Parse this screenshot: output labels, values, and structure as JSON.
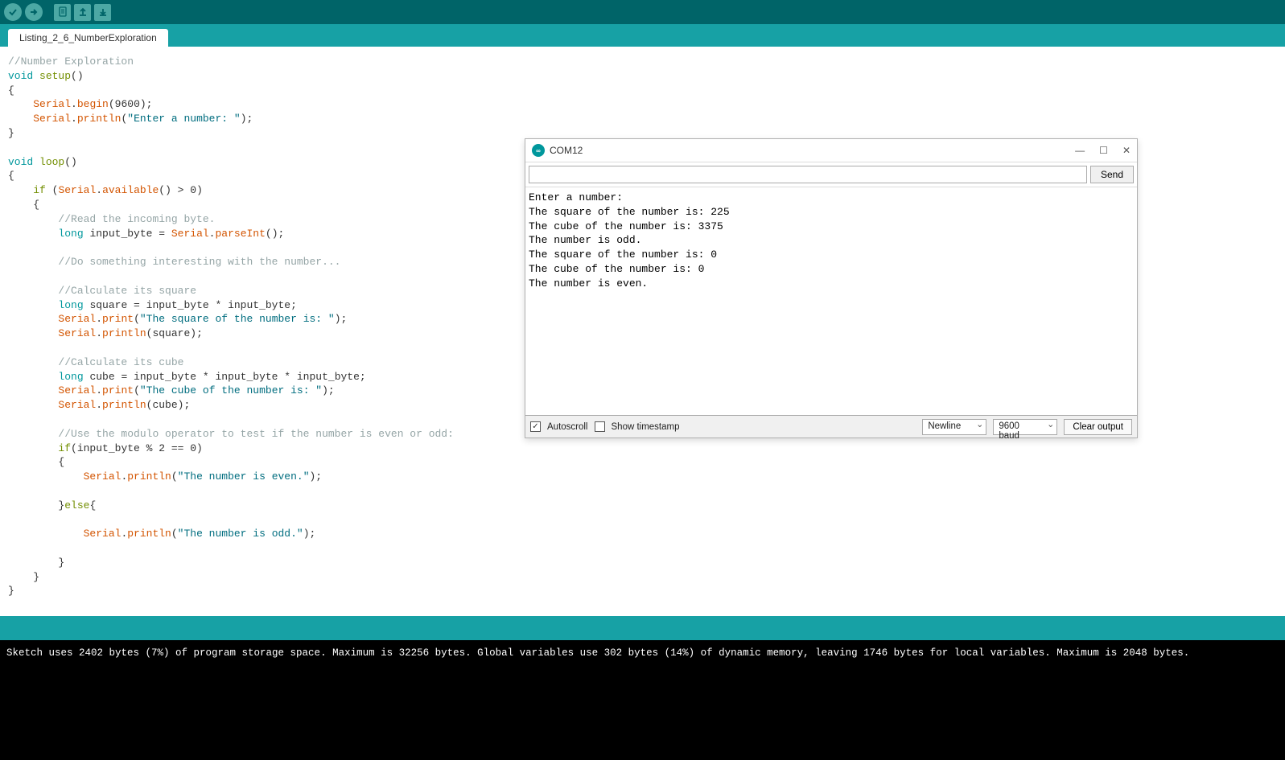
{
  "tab": {
    "name": "Listing_2_6_NumberExploration"
  },
  "code": {
    "tokens": [
      [
        {
          "t": "//Number Exploration",
          "c": "comment"
        }
      ],
      [
        {
          "t": "void",
          "c": "kw-teal"
        },
        {
          "t": " "
        },
        {
          "t": "setup",
          "c": "kw-green"
        },
        {
          "t": "()"
        }
      ],
      [
        {
          "t": "{"
        }
      ],
      [
        {
          "t": "    "
        },
        {
          "t": "Serial",
          "c": "kw-orange"
        },
        {
          "t": "."
        },
        {
          "t": "begin",
          "c": "kw-orange"
        },
        {
          "t": "(9600);"
        }
      ],
      [
        {
          "t": "    "
        },
        {
          "t": "Serial",
          "c": "kw-orange"
        },
        {
          "t": "."
        },
        {
          "t": "println",
          "c": "kw-orange"
        },
        {
          "t": "("
        },
        {
          "t": "\"Enter a number: \"",
          "c": "string"
        },
        {
          "t": ");"
        }
      ],
      [
        {
          "t": "}"
        }
      ],
      [],
      [
        {
          "t": "void",
          "c": "kw-teal"
        },
        {
          "t": " "
        },
        {
          "t": "loop",
          "c": "kw-green"
        },
        {
          "t": "()"
        }
      ],
      [
        {
          "t": "{"
        }
      ],
      [
        {
          "t": "    "
        },
        {
          "t": "if",
          "c": "kw-green"
        },
        {
          "t": " ("
        },
        {
          "t": "Serial",
          "c": "kw-orange"
        },
        {
          "t": "."
        },
        {
          "t": "available",
          "c": "kw-orange"
        },
        {
          "t": "() > 0)"
        }
      ],
      [
        {
          "t": "    {"
        }
      ],
      [
        {
          "t": "        "
        },
        {
          "t": "//Read the incoming byte.",
          "c": "comment"
        }
      ],
      [
        {
          "t": "        "
        },
        {
          "t": "long",
          "c": "kw-teal"
        },
        {
          "t": " input_byte = "
        },
        {
          "t": "Serial",
          "c": "kw-orange"
        },
        {
          "t": "."
        },
        {
          "t": "parseInt",
          "c": "kw-orange"
        },
        {
          "t": "();"
        }
      ],
      [],
      [
        {
          "t": "        "
        },
        {
          "t": "//Do something interesting with the number...",
          "c": "comment"
        }
      ],
      [],
      [
        {
          "t": "        "
        },
        {
          "t": "//Calculate its square",
          "c": "comment"
        }
      ],
      [
        {
          "t": "        "
        },
        {
          "t": "long",
          "c": "kw-teal"
        },
        {
          "t": " square = input_byte * input_byte;"
        }
      ],
      [
        {
          "t": "        "
        },
        {
          "t": "Serial",
          "c": "kw-orange"
        },
        {
          "t": "."
        },
        {
          "t": "print",
          "c": "kw-orange"
        },
        {
          "t": "("
        },
        {
          "t": "\"The square of the number is: \"",
          "c": "string"
        },
        {
          "t": ");"
        }
      ],
      [
        {
          "t": "        "
        },
        {
          "t": "Serial",
          "c": "kw-orange"
        },
        {
          "t": "."
        },
        {
          "t": "println",
          "c": "kw-orange"
        },
        {
          "t": "(square);"
        }
      ],
      [],
      [
        {
          "t": "        "
        },
        {
          "t": "//Calculate its cube",
          "c": "comment"
        }
      ],
      [
        {
          "t": "        "
        },
        {
          "t": "long",
          "c": "kw-teal"
        },
        {
          "t": " cube = input_byte * input_byte * input_byte;"
        }
      ],
      [
        {
          "t": "        "
        },
        {
          "t": "Serial",
          "c": "kw-orange"
        },
        {
          "t": "."
        },
        {
          "t": "print",
          "c": "kw-orange"
        },
        {
          "t": "("
        },
        {
          "t": "\"The cube of the number is: \"",
          "c": "string"
        },
        {
          "t": ");"
        }
      ],
      [
        {
          "t": "        "
        },
        {
          "t": "Serial",
          "c": "kw-orange"
        },
        {
          "t": "."
        },
        {
          "t": "println",
          "c": "kw-orange"
        },
        {
          "t": "(cube);"
        }
      ],
      [],
      [
        {
          "t": "        "
        },
        {
          "t": "//Use the modulo operator to test if the number is even or odd:",
          "c": "comment"
        }
      ],
      [
        {
          "t": "        "
        },
        {
          "t": "if",
          "c": "kw-green"
        },
        {
          "t": "(input_byte % 2 == 0)"
        }
      ],
      [
        {
          "t": "        {"
        }
      ],
      [
        {
          "t": "            "
        },
        {
          "t": "Serial",
          "c": "kw-orange"
        },
        {
          "t": "."
        },
        {
          "t": "println",
          "c": "kw-orange"
        },
        {
          "t": "("
        },
        {
          "t": "\"The number is even.\"",
          "c": "string"
        },
        {
          "t": ");"
        }
      ],
      [],
      [
        {
          "t": "        }"
        },
        {
          "t": "else",
          "c": "kw-green"
        },
        {
          "t": "{"
        }
      ],
      [],
      [
        {
          "t": "            "
        },
        {
          "t": "Serial",
          "c": "kw-orange"
        },
        {
          "t": "."
        },
        {
          "t": "println",
          "c": "kw-orange"
        },
        {
          "t": "("
        },
        {
          "t": "\"The number is odd.\"",
          "c": "string"
        },
        {
          "t": ");"
        }
      ],
      [],
      [
        {
          "t": "        }"
        }
      ],
      [
        {
          "t": "    }"
        }
      ],
      [
        {
          "t": "}"
        }
      ]
    ]
  },
  "console": {
    "lines": [
      "Sketch uses 2402 bytes (7%) of program storage space. Maximum is 32256 bytes.",
      "Global variables use 302 bytes (14%) of dynamic memory, leaving 1746 bytes for local variables. Maximum is 2048 bytes."
    ]
  },
  "serial": {
    "title": "COM12",
    "send_label": "Send",
    "output": [
      "Enter a number:",
      "The square of the number is: 225",
      "The cube of the number is: 3375",
      "The number is odd.",
      "The square of the number is: 0",
      "The cube of the number is: 0",
      "The number is even."
    ],
    "autoscroll_label": "Autoscroll",
    "timestamp_label": "Show timestamp",
    "line_ending": "Newline",
    "baud": "9600 baud",
    "clear_label": "Clear output",
    "autoscroll_checked": true,
    "timestamp_checked": false
  }
}
